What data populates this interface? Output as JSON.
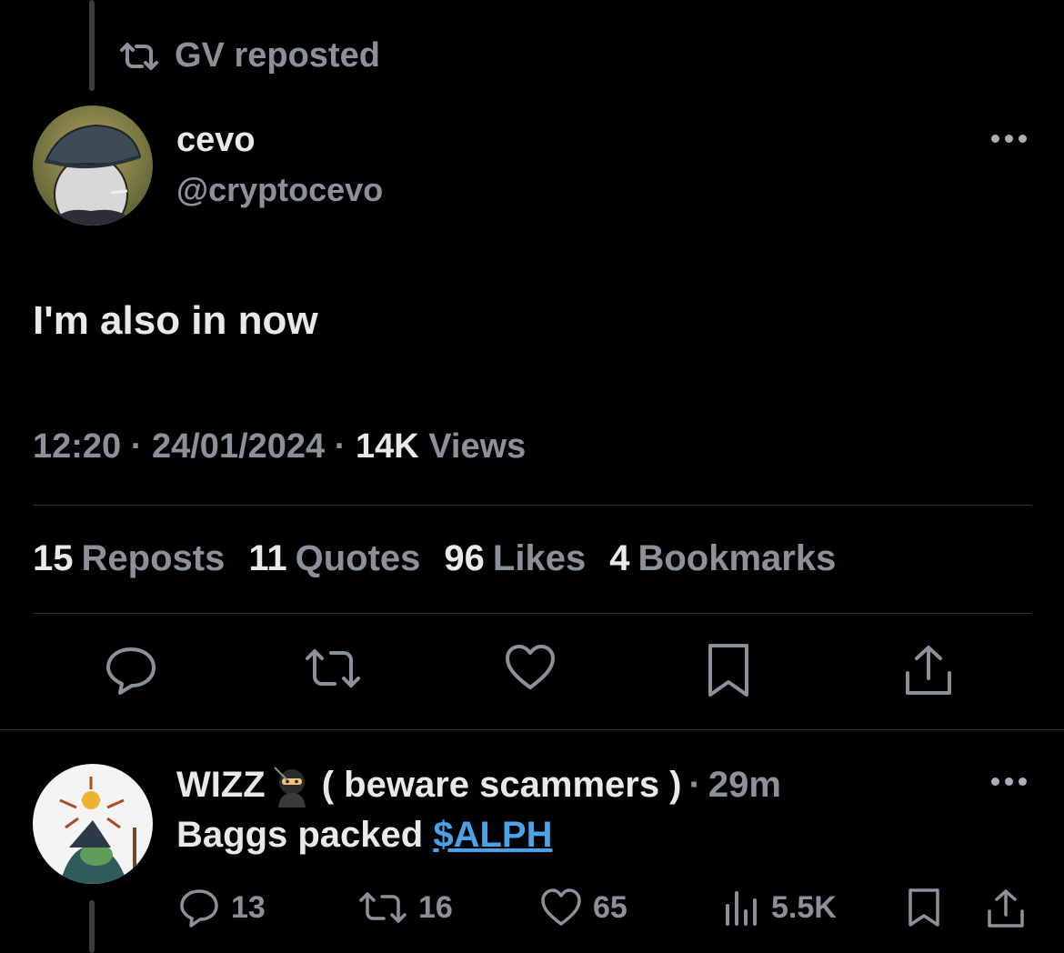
{
  "repost": {
    "label": "GV reposted",
    "icon": "repost-icon"
  },
  "tweet": {
    "author_name": "cevo",
    "author_handle": "@cryptocevo",
    "text": "I'm also in now",
    "time": "12:20",
    "date": "24/01/2024",
    "views_count": "14K",
    "views_label": "Views",
    "stats": [
      {
        "count": "15",
        "label": "Reposts"
      },
      {
        "count": "11",
        "label": "Quotes"
      },
      {
        "count": "96",
        "label": "Likes"
      },
      {
        "count": "4",
        "label": "Bookmarks"
      }
    ],
    "actions": [
      "reply-icon",
      "repost-icon",
      "like-icon",
      "bookmark-icon",
      "share-icon"
    ]
  },
  "reply": {
    "author_name": "WIZZ",
    "author_suffix": "( beware scammers )",
    "separator": "·",
    "time": "29m",
    "text_prefix": "Baggs packed",
    "cashtag": "$ALPH",
    "metrics": {
      "replies": "13",
      "reposts": "16",
      "likes": "65",
      "views": "5.5K"
    }
  },
  "colors": {
    "background": "#000000",
    "text": "#e7e9ea",
    "secondary": "#8b9198",
    "link": "#4aa3e8",
    "divider": "#2f3336"
  }
}
